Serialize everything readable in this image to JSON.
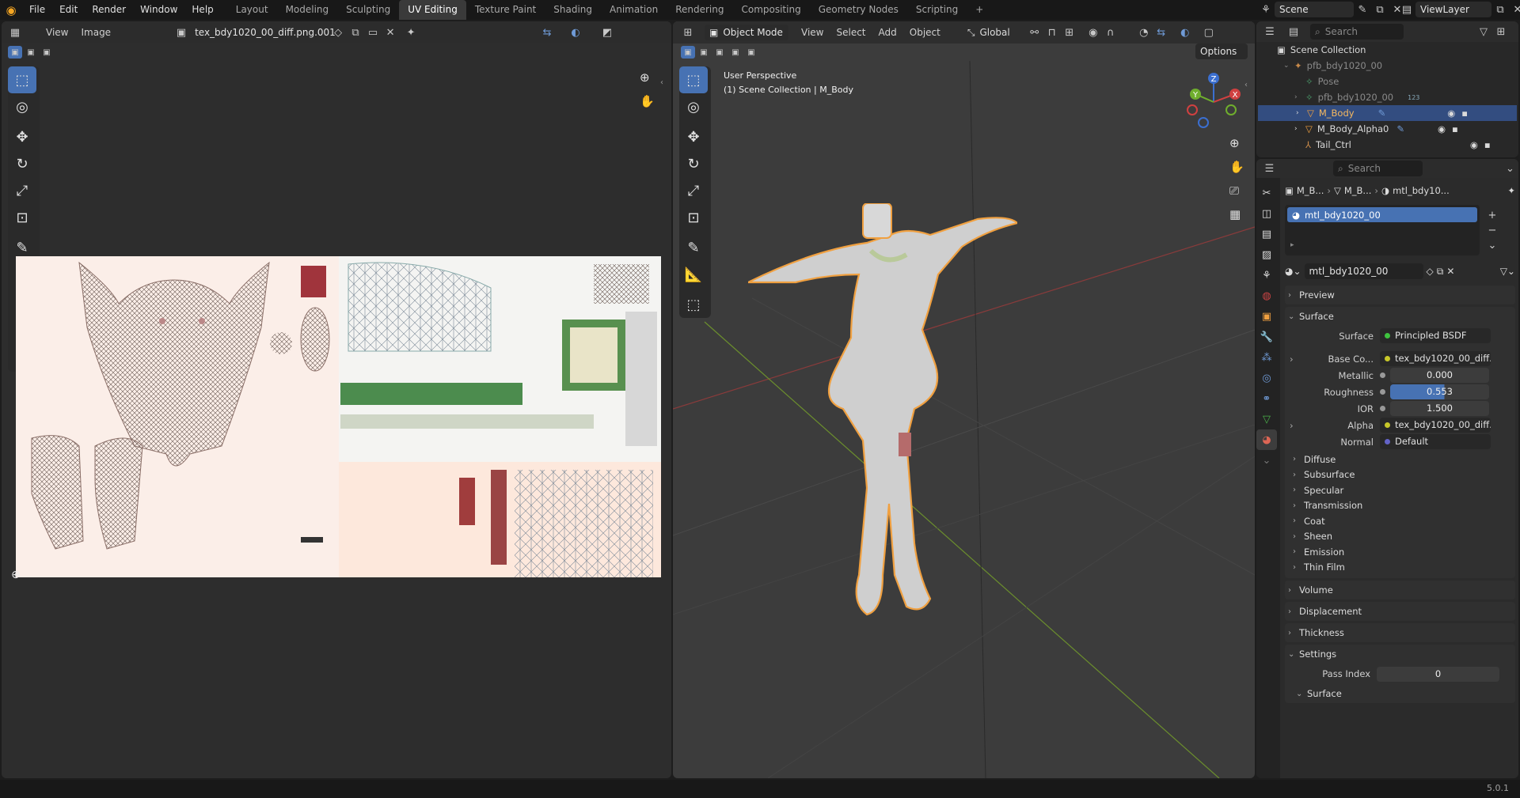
{
  "topbar": {
    "menu": [
      "File",
      "Edit",
      "Render",
      "Window",
      "Help"
    ],
    "workspaces": [
      "Layout",
      "Modeling",
      "Sculpting",
      "UV Editing",
      "Texture Paint",
      "Shading",
      "Animation",
      "Rendering",
      "Compositing",
      "Geometry Nodes",
      "Scripting"
    ],
    "active_workspace": "UV Editing",
    "add_tab": "+",
    "scene": "Scene",
    "view_layer": "ViewLayer"
  },
  "uv_editor": {
    "menu": [
      "View",
      "Image"
    ],
    "image_name": "tex_bdy1020_00_diff.png.001"
  },
  "viewport": {
    "mode": "Object Mode",
    "menu": [
      "View",
      "Select",
      "Add",
      "Object"
    ],
    "orientation": "Global",
    "options_label": "Options",
    "overlay_line1": "User Perspective",
    "overlay_line2": "(1) Scene Collection | M_Body",
    "gizmo": {
      "x": "X",
      "y": "Y",
      "z": "Z"
    }
  },
  "outliner": {
    "search_placeholder": "Search",
    "root": "Scene Collection",
    "items": [
      {
        "label": "pfb_bdy1020_00",
        "dim": true
      },
      {
        "label": "Pose",
        "dim": true
      },
      {
        "label": "pfb_bdy1020_00",
        "dim": true,
        "badge": "123"
      },
      {
        "label": "M_Body",
        "selected": true
      },
      {
        "label": "M_Body_Alpha0"
      },
      {
        "label": "Tail_Ctrl"
      }
    ]
  },
  "properties": {
    "search_placeholder": "Search",
    "breadcrumb": [
      "M_B...",
      "M_B...",
      "mtl_bdy10..."
    ],
    "slot": "mtl_bdy1020_00",
    "material_name": "mtl_bdy1020_00",
    "sections_top": [
      "Preview",
      "Surface"
    ],
    "surface_label": "Surface",
    "surface_value": "Principled BSDF",
    "fields": [
      {
        "label": "Base Co...",
        "value": "tex_bdy1020_00_diff...",
        "kind": "link",
        "color": "#c7c729"
      },
      {
        "label": "Metallic",
        "value": "0.000",
        "kind": "num"
      },
      {
        "label": "Roughness",
        "value": "0.553",
        "kind": "slider",
        "fraction": 0.553
      },
      {
        "label": "IOR",
        "value": "1.500",
        "kind": "num"
      },
      {
        "label": "Alpha",
        "value": "tex_bdy1020_00_diff...",
        "kind": "link",
        "color": "#c7c729"
      },
      {
        "label": "Normal",
        "value": "Default",
        "kind": "link",
        "color": "#6363c7"
      }
    ],
    "subsections": [
      "Diffuse",
      "Subsurface",
      "Specular",
      "Transmission",
      "Coat",
      "Sheen",
      "Emission",
      "Thin Film"
    ],
    "sections_bottom": [
      "Volume",
      "Displacement",
      "Thickness",
      "Settings"
    ],
    "pass_index_label": "Pass Index",
    "pass_index_value": "0",
    "settings_sub": "Surface"
  },
  "status": {
    "version": "5.0.1"
  },
  "colors": {
    "accent": "#4772b3",
    "selection_orange": "#f0a040",
    "header": "#2c2c2c",
    "panel": "#303030"
  }
}
